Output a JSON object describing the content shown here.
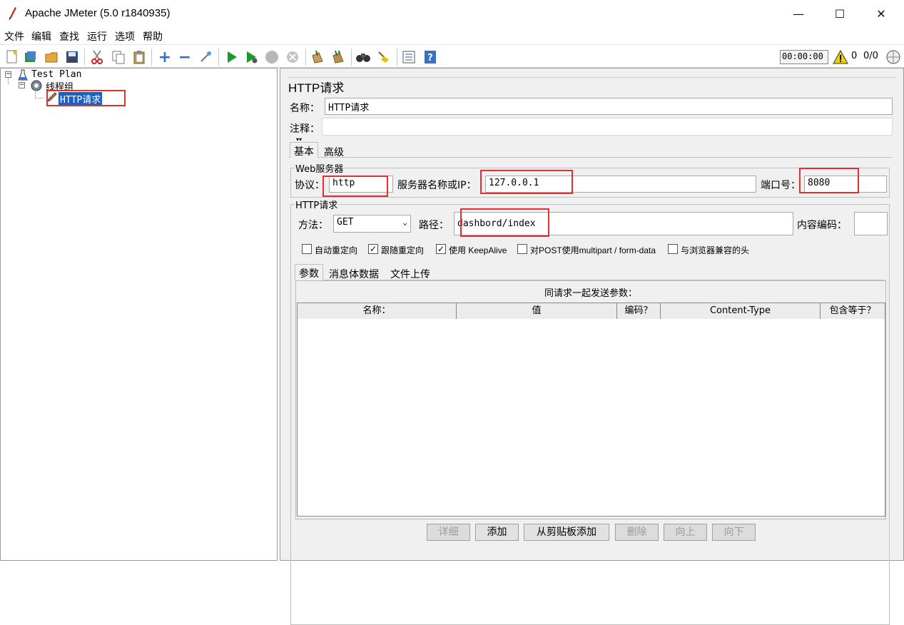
{
  "window": {
    "title": "Apache JMeter (5.0 r1840935)",
    "minimize": "—",
    "maximize": "☐",
    "close": "✕"
  },
  "menu": [
    "文件",
    "编辑",
    "查找",
    "运行",
    "选项",
    "帮助"
  ],
  "toolbar": {
    "timer": "00:00:00",
    "warning_count": "0",
    "thread_count": "0/0"
  },
  "tree": {
    "test_plan": "Test Plan",
    "thread_group": "线程组",
    "http_request": "HTTP请求"
  },
  "panel": {
    "title": "HTTP请求",
    "name_label": "名称：",
    "name_value": "HTTP请求",
    "comment_label": "注释：",
    "comment_value": "",
    "tabs": [
      "基本",
      "高级"
    ],
    "web_server": {
      "title": "Web服务器",
      "protocol_label": "协议：",
      "protocol_value": "http",
      "server_label": "服务器名称或IP：",
      "server_value": "127.0.0.1",
      "port_label": "端口号：",
      "port_value": "8080"
    },
    "http_request": {
      "title": "HTTP请求",
      "method_label": "方法：",
      "method_value": "GET",
      "path_label": "路径：",
      "path_value": "dashbord/index",
      "encoding_label": "内容编码：",
      "encoding_value": ""
    },
    "checkboxes": [
      {
        "label": "自动重定向",
        "checked": false
      },
      {
        "label": "跟随重定向",
        "checked": true
      },
      {
        "label": "使用 KeepAlive",
        "checked": true
      },
      {
        "label": "对POST使用multipart / form-data",
        "checked": false
      },
      {
        "label": "与浏览器兼容的头",
        "checked": false
      }
    ],
    "sub_tabs": [
      "参数",
      "消息体数据",
      "文件上传"
    ],
    "params_caption": "同请求一起发送参数：",
    "columns": [
      "名称：",
      "值",
      "编码？",
      "Content-Type",
      "包含等于？"
    ],
    "buttons": {
      "detail": "详细",
      "add": "添加",
      "add_clipboard": "从剪贴板添加",
      "delete": "删除",
      "up": "向上",
      "down": "向下"
    }
  },
  "colors": {
    "highlight": "#e03030",
    "selection": "#1c5fbf"
  }
}
